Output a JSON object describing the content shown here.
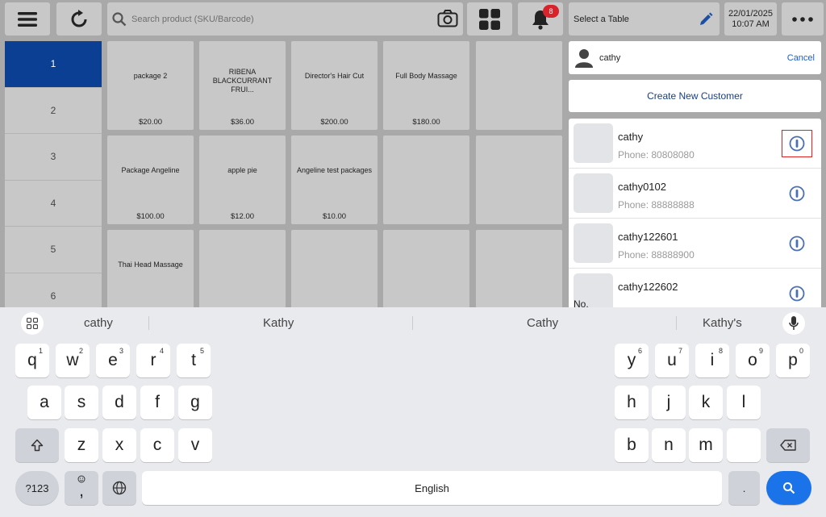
{
  "topbar": {
    "search_placeholder": "Search product (SKU/Barcode)",
    "notification_count": "8",
    "table_label": "Select a Table",
    "date": "22/01/2025",
    "time": "10:07 AM",
    "icons": [
      "menu-icon",
      "refresh-icon",
      "search-icon",
      "camera-icon",
      "grid-icon",
      "bell-icon",
      "pencil-icon",
      "more-icon"
    ]
  },
  "categories": [
    "1",
    "2",
    "3",
    "4",
    "5",
    "6"
  ],
  "products": [
    {
      "name": "package 2",
      "price": "$20.00"
    },
    {
      "name": "RIBENA BLACKCURRANT FRUI...",
      "price": "$36.00"
    },
    {
      "name": "Director's Hair Cut",
      "price": "$200.00"
    },
    {
      "name": "Full Body Massage",
      "price": "$180.00"
    },
    {
      "name": "",
      "price": ""
    },
    {
      "name": "Package Angeline",
      "price": "$100.00"
    },
    {
      "name": "apple pie",
      "price": "$12.00"
    },
    {
      "name": "Angeline test packages",
      "price": "$10.00"
    },
    {
      "name": "",
      "price": ""
    },
    {
      "name": "",
      "price": ""
    },
    {
      "name": "Thai Head Massage",
      "price": ""
    },
    {
      "name": "",
      "price": ""
    },
    {
      "name": "",
      "price": ""
    },
    {
      "name": "",
      "price": ""
    },
    {
      "name": "",
      "price": ""
    }
  ],
  "customer_panel": {
    "search_value": "cathy",
    "cancel_label": "Cancel",
    "create_label": "Create New Customer",
    "customers": [
      {
        "name": "cathy",
        "phone": "Phone: 80808080"
      },
      {
        "name": "cathy0102",
        "phone": "Phone: 88888888"
      },
      {
        "name": "cathy122601",
        "phone": "Phone: 88888900"
      },
      {
        "name": "cathy122602",
        "phone": ""
      }
    ],
    "no_label": "No."
  },
  "keyboard": {
    "suggestions": [
      "cathy",
      "Kathy",
      "Cathy",
      "Kathy's"
    ],
    "row1": [
      {
        "k": "q",
        "s": "1"
      },
      {
        "k": "w",
        "s": "2"
      },
      {
        "k": "e",
        "s": "3"
      },
      {
        "k": "r",
        "s": "4"
      },
      {
        "k": "t",
        "s": "5"
      },
      {
        "k": "y",
        "s": "6"
      },
      {
        "k": "u",
        "s": "7"
      },
      {
        "k": "i",
        "s": "8"
      },
      {
        "k": "o",
        "s": "9"
      },
      {
        "k": "p",
        "s": "0"
      }
    ],
    "row2": [
      "a",
      "s",
      "d",
      "f",
      "g",
      "h",
      "j",
      "k",
      "l"
    ],
    "row3": [
      "z",
      "x",
      "c",
      "v",
      "b",
      "n",
      "m"
    ],
    "symbols_label": "?123",
    "comma": ",",
    "space_label": "English",
    "period": "."
  }
}
